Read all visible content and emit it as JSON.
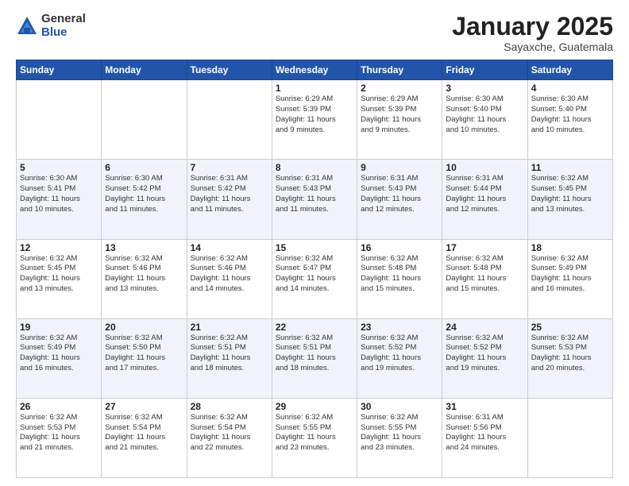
{
  "logo": {
    "general": "General",
    "blue": "Blue"
  },
  "header": {
    "month": "January 2025",
    "location": "Sayaxche, Guatemala"
  },
  "weekdays": [
    "Sunday",
    "Monday",
    "Tuesday",
    "Wednesday",
    "Thursday",
    "Friday",
    "Saturday"
  ],
  "weeks": [
    [
      {
        "day": "",
        "info": ""
      },
      {
        "day": "",
        "info": ""
      },
      {
        "day": "",
        "info": ""
      },
      {
        "day": "1",
        "info": "Sunrise: 6:29 AM\nSunset: 5:39 PM\nDaylight: 11 hours\nand 9 minutes."
      },
      {
        "day": "2",
        "info": "Sunrise: 6:29 AM\nSunset: 5:39 PM\nDaylight: 11 hours\nand 9 minutes."
      },
      {
        "day": "3",
        "info": "Sunrise: 6:30 AM\nSunset: 5:40 PM\nDaylight: 11 hours\nand 10 minutes."
      },
      {
        "day": "4",
        "info": "Sunrise: 6:30 AM\nSunset: 5:40 PM\nDaylight: 11 hours\nand 10 minutes."
      }
    ],
    [
      {
        "day": "5",
        "info": "Sunrise: 6:30 AM\nSunset: 5:41 PM\nDaylight: 11 hours\nand 10 minutes."
      },
      {
        "day": "6",
        "info": "Sunrise: 6:30 AM\nSunset: 5:42 PM\nDaylight: 11 hours\nand 11 minutes."
      },
      {
        "day": "7",
        "info": "Sunrise: 6:31 AM\nSunset: 5:42 PM\nDaylight: 11 hours\nand 11 minutes."
      },
      {
        "day": "8",
        "info": "Sunrise: 6:31 AM\nSunset: 5:43 PM\nDaylight: 11 hours\nand 11 minutes."
      },
      {
        "day": "9",
        "info": "Sunrise: 6:31 AM\nSunset: 5:43 PM\nDaylight: 11 hours\nand 12 minutes."
      },
      {
        "day": "10",
        "info": "Sunrise: 6:31 AM\nSunset: 5:44 PM\nDaylight: 11 hours\nand 12 minutes."
      },
      {
        "day": "11",
        "info": "Sunrise: 6:32 AM\nSunset: 5:45 PM\nDaylight: 11 hours\nand 13 minutes."
      }
    ],
    [
      {
        "day": "12",
        "info": "Sunrise: 6:32 AM\nSunset: 5:45 PM\nDaylight: 11 hours\nand 13 minutes."
      },
      {
        "day": "13",
        "info": "Sunrise: 6:32 AM\nSunset: 5:46 PM\nDaylight: 11 hours\nand 13 minutes."
      },
      {
        "day": "14",
        "info": "Sunrise: 6:32 AM\nSunset: 5:46 PM\nDaylight: 11 hours\nand 14 minutes."
      },
      {
        "day": "15",
        "info": "Sunrise: 6:32 AM\nSunset: 5:47 PM\nDaylight: 11 hours\nand 14 minutes."
      },
      {
        "day": "16",
        "info": "Sunrise: 6:32 AM\nSunset: 5:48 PM\nDaylight: 11 hours\nand 15 minutes."
      },
      {
        "day": "17",
        "info": "Sunrise: 6:32 AM\nSunset: 5:48 PM\nDaylight: 11 hours\nand 15 minutes."
      },
      {
        "day": "18",
        "info": "Sunrise: 6:32 AM\nSunset: 5:49 PM\nDaylight: 11 hours\nand 16 minutes."
      }
    ],
    [
      {
        "day": "19",
        "info": "Sunrise: 6:32 AM\nSunset: 5:49 PM\nDaylight: 11 hours\nand 16 minutes."
      },
      {
        "day": "20",
        "info": "Sunrise: 6:32 AM\nSunset: 5:50 PM\nDaylight: 11 hours\nand 17 minutes."
      },
      {
        "day": "21",
        "info": "Sunrise: 6:32 AM\nSunset: 5:51 PM\nDaylight: 11 hours\nand 18 minutes."
      },
      {
        "day": "22",
        "info": "Sunrise: 6:32 AM\nSunset: 5:51 PM\nDaylight: 11 hours\nand 18 minutes."
      },
      {
        "day": "23",
        "info": "Sunrise: 6:32 AM\nSunset: 5:52 PM\nDaylight: 11 hours\nand 19 minutes."
      },
      {
        "day": "24",
        "info": "Sunrise: 6:32 AM\nSunset: 5:52 PM\nDaylight: 11 hours\nand 19 minutes."
      },
      {
        "day": "25",
        "info": "Sunrise: 6:32 AM\nSunset: 5:53 PM\nDaylight: 11 hours\nand 20 minutes."
      }
    ],
    [
      {
        "day": "26",
        "info": "Sunrise: 6:32 AM\nSunset: 5:53 PM\nDaylight: 11 hours\nand 21 minutes."
      },
      {
        "day": "27",
        "info": "Sunrise: 6:32 AM\nSunset: 5:54 PM\nDaylight: 11 hours\nand 21 minutes."
      },
      {
        "day": "28",
        "info": "Sunrise: 6:32 AM\nSunset: 5:54 PM\nDaylight: 11 hours\nand 22 minutes."
      },
      {
        "day": "29",
        "info": "Sunrise: 6:32 AM\nSunset: 5:55 PM\nDaylight: 11 hours\nand 23 minutes."
      },
      {
        "day": "30",
        "info": "Sunrise: 6:32 AM\nSunset: 5:55 PM\nDaylight: 11 hours\nand 23 minutes."
      },
      {
        "day": "31",
        "info": "Sunrise: 6:31 AM\nSunset: 5:56 PM\nDaylight: 11 hours\nand 24 minutes."
      },
      {
        "day": "",
        "info": ""
      }
    ]
  ]
}
